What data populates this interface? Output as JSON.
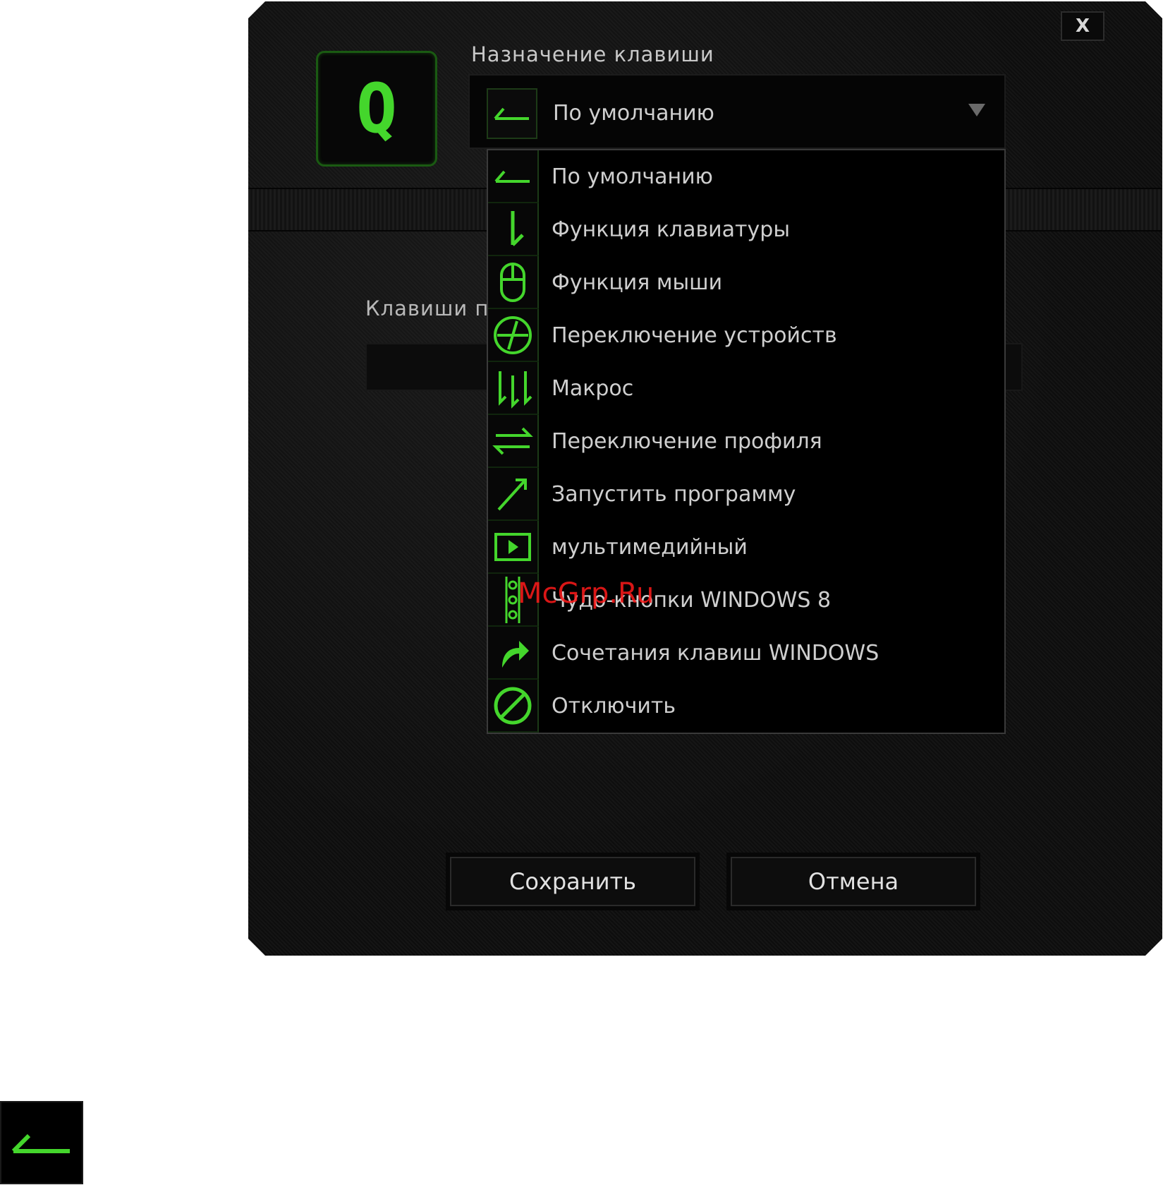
{
  "dialog": {
    "close_label": "X",
    "key_label": "Q",
    "assign_title": "Назначение клавиши",
    "selected_value": "По умолчанию",
    "keys_label": "Клавиши п",
    "save_label": "Сохранить",
    "cancel_label": "Отмена"
  },
  "dropdown": {
    "items": [
      {
        "label": "По умолчанию",
        "icon": "default-arrow-icon"
      },
      {
        "label": "Функция клавиатуры",
        "icon": "keyboard-function-icon"
      },
      {
        "label": "Функция мыши",
        "icon": "mouse-icon"
      },
      {
        "label": "Переключение устройств",
        "icon": "device-switch-icon"
      },
      {
        "label": "Макрос",
        "icon": "macro-icon"
      },
      {
        "label": "Переключение профиля",
        "icon": "profile-switch-icon"
      },
      {
        "label": "Запустить программу",
        "icon": "launch-program-icon"
      },
      {
        "label": "мультимедийный",
        "icon": "multimedia-icon"
      },
      {
        "label": "Чудо-кнопки WINDOWS 8",
        "icon": "windows8-charms-icon"
      },
      {
        "label": "Сочетания клавиш WINDOWS",
        "icon": "windows-shortcut-icon"
      },
      {
        "label": "Отключить",
        "icon": "disable-icon"
      }
    ]
  },
  "watermark": "McGrp.Ru",
  "colors": {
    "accent": "#44d62c",
    "background": "#0d0d0d",
    "text": "#cfcfcf"
  }
}
